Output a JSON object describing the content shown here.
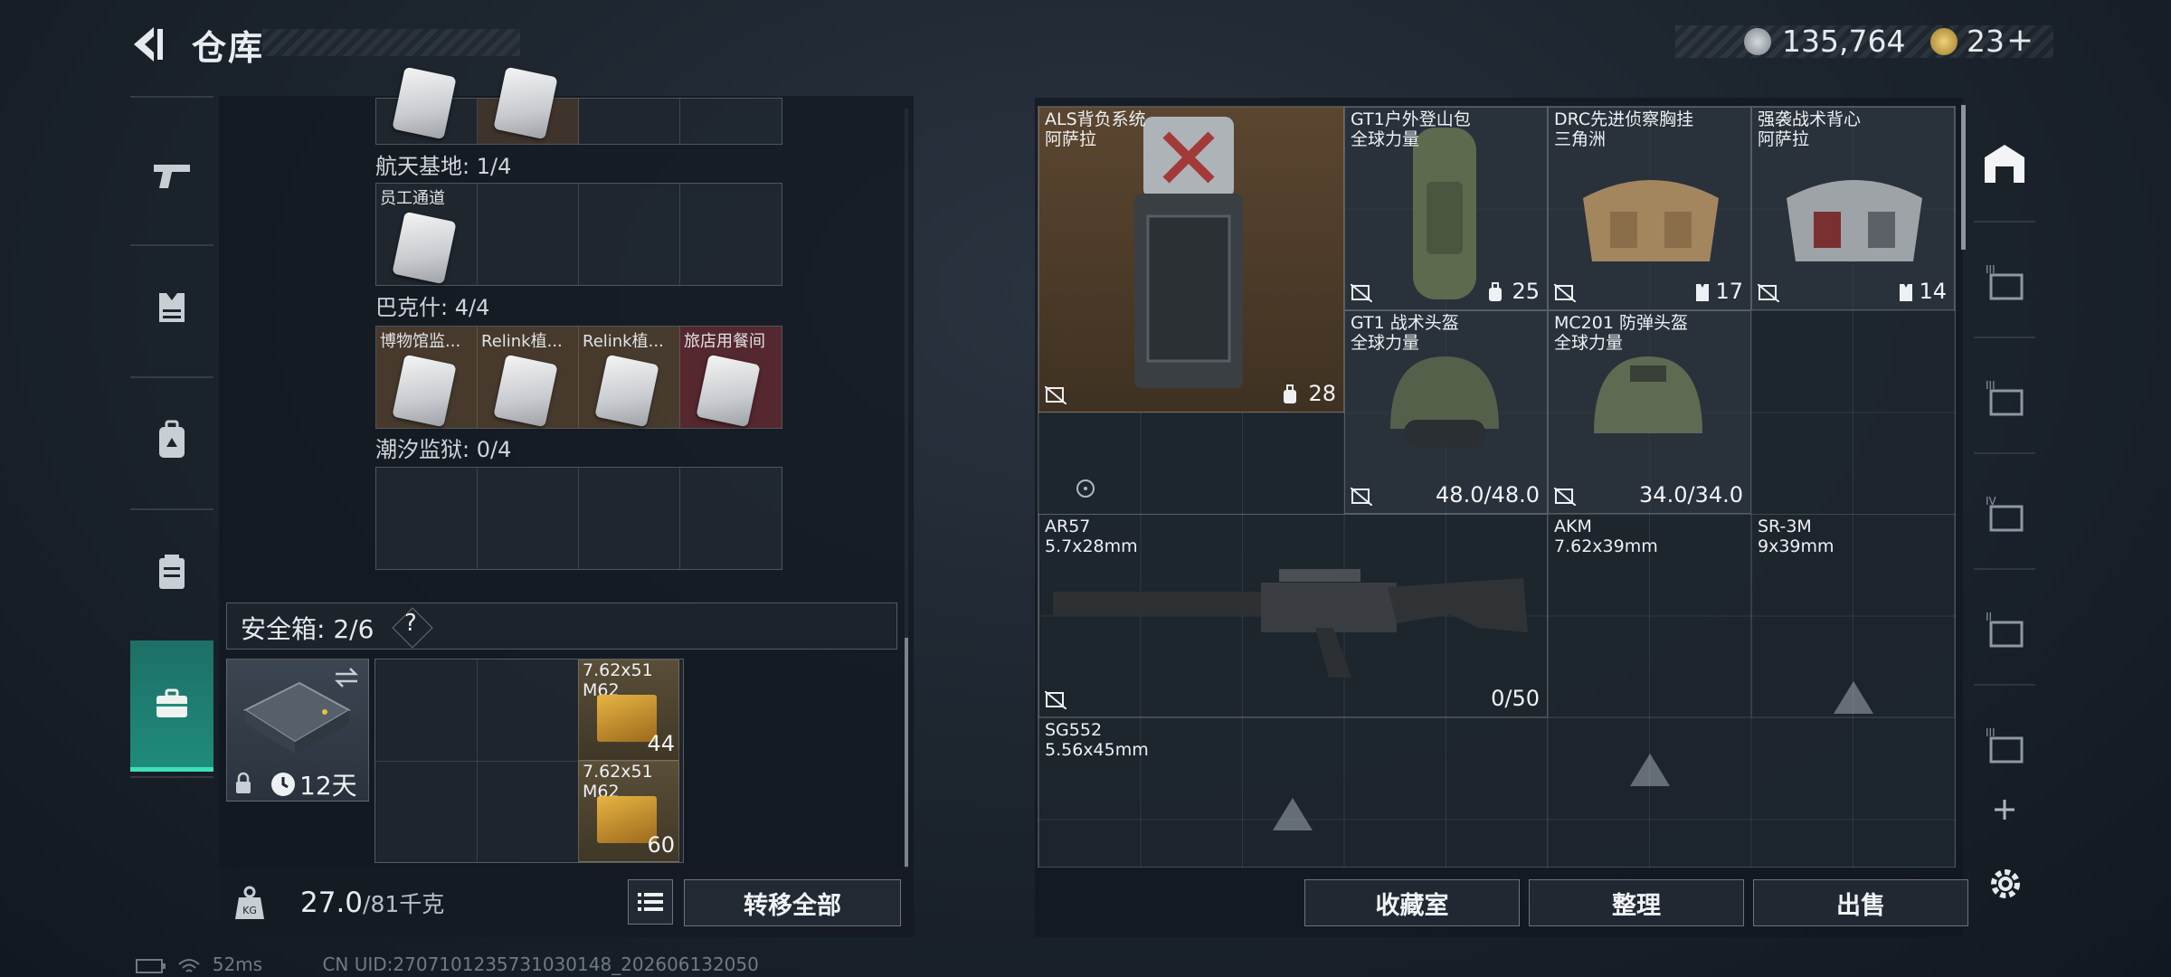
{
  "header": {
    "title": "仓库",
    "currency": {
      "coins": "135,764",
      "premium": "23",
      "plus": "+"
    }
  },
  "left_nav": {
    "items": [
      {
        "name": "weapons-tab",
        "icon": "pistol-icon"
      },
      {
        "name": "armor-tab",
        "icon": "vest-icon"
      },
      {
        "name": "backpack-tab",
        "icon": "backpack-icon"
      },
      {
        "name": "chest-rig-tab",
        "icon": "rig-icon"
      },
      {
        "name": "key-case-tab",
        "icon": "briefcase-icon",
        "active": true
      }
    ]
  },
  "key_sections": [
    {
      "label": "航天基地: 1/4",
      "slots": [
        "员工通道",
        "",
        "",
        ""
      ]
    },
    {
      "label": "巴克什: 4/4",
      "slots": [
        "博物馆监...",
        "Relink植...",
        "Relink植...",
        "旅店用餐间"
      ]
    },
    {
      "label": "潮汐监狱: 0/4",
      "slots": [
        "",
        "",
        "",
        ""
      ]
    }
  ],
  "safe_box": {
    "label": "安全箱: 2/6",
    "help": "?",
    "days": "12天",
    "ammo": [
      {
        "name1": "7.62x51",
        "name2": "M62",
        "count": "44"
      },
      {
        "name1": "7.62x51",
        "name2": "M62",
        "count": "60"
      }
    ]
  },
  "weight": {
    "current": "27.0",
    "max": "/81千克"
  },
  "buttons": {
    "transfer_all": "转移全部",
    "collection": "收藏室",
    "organize": "整理",
    "sell": "出售"
  },
  "stash_items": [
    {
      "name1": "ALS背负系统",
      "name2": "阿萨拉",
      "value": "28"
    },
    {
      "name1": "GT1户外登山包",
      "name2": "全球力量",
      "value": "25"
    },
    {
      "name1": "DRC先进侦察胸挂",
      "name2": "三角洲",
      "value": "17"
    },
    {
      "name1": "强袭战术背心",
      "name2": "阿萨拉",
      "value": "14"
    },
    {
      "name1": "GT1 战术头盔",
      "name2": "全球力量",
      "value": "48.0/48.0"
    },
    {
      "name1": "MC201 防弹头盔",
      "name2": "全球力量",
      "value": "34.0/34.0"
    },
    {
      "name1": "AR57",
      "name2": "5.7x28mm",
      "value": "0/50"
    },
    {
      "name1": "AKM",
      "name2": "7.62x39mm",
      "value": ""
    },
    {
      "name1": "SR-3M",
      "name2": "9x39mm",
      "value": ""
    },
    {
      "name1": "SG552",
      "name2": "5.56x45mm",
      "value": ""
    }
  ],
  "status": {
    "ping": "52ms",
    "uid": "CN UID:2707101235731030148_202606132050"
  },
  "colors": {
    "accent": "#3de0b8",
    "tab_active": "#1f8b7b",
    "backpack_bg": "#4a3a2a",
    "sell_red": "#6a2a2e"
  }
}
